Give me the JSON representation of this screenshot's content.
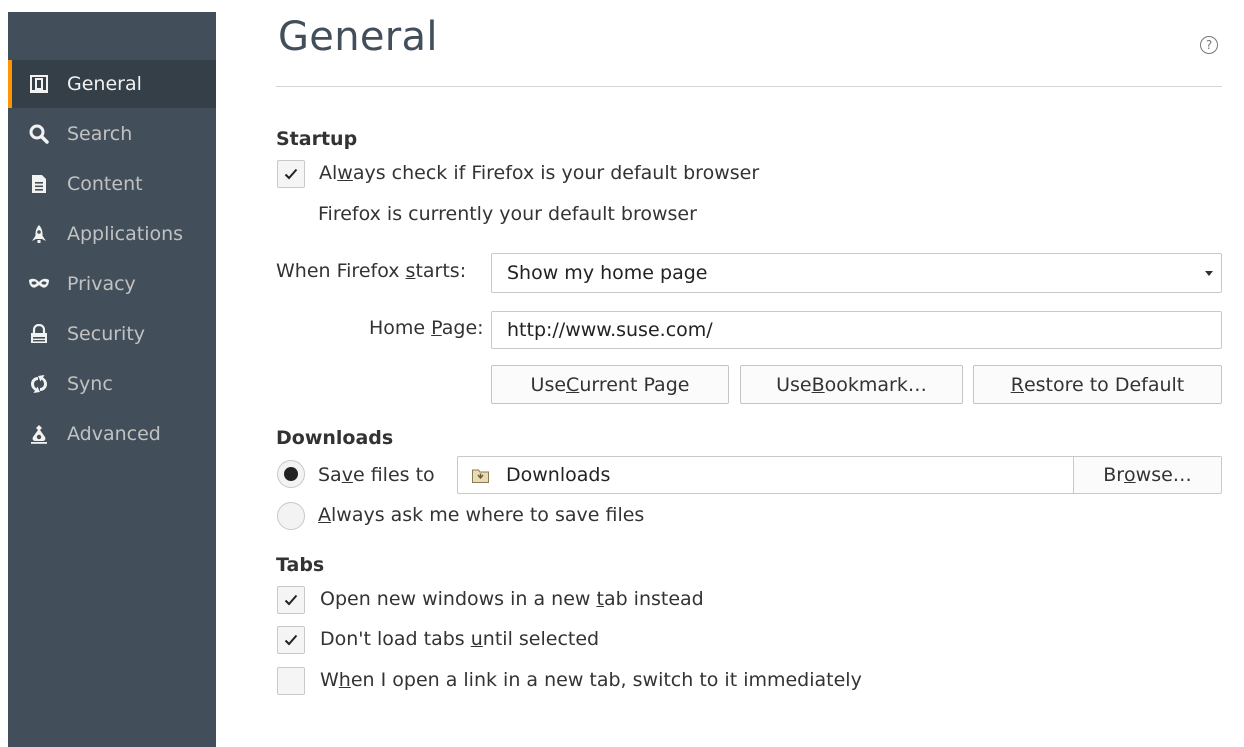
{
  "sidebar": {
    "items": [
      {
        "label": "General",
        "icon": "general-icon",
        "selected": true
      },
      {
        "label": "Search",
        "icon": "search-icon",
        "selected": false
      },
      {
        "label": "Content",
        "icon": "content-icon",
        "selected": false
      },
      {
        "label": "Applications",
        "icon": "applications-icon",
        "selected": false
      },
      {
        "label": "Privacy",
        "icon": "privacy-icon",
        "selected": false
      },
      {
        "label": "Security",
        "icon": "security-icon",
        "selected": false
      },
      {
        "label": "Sync",
        "icon": "sync-icon",
        "selected": false
      },
      {
        "label": "Advanced",
        "icon": "advanced-icon",
        "selected": false
      }
    ]
  },
  "main": {
    "title": "General",
    "help_icon": "?",
    "startup": {
      "header": "Startup",
      "default_check": {
        "pre": "Al",
        "u": "w",
        "post": "ays check if Firefox is your default browser",
        "checked": true
      },
      "default_status": "Firefox is currently your default browser",
      "when_starts": {
        "pre": "When Firefox ",
        "u": "s",
        "post": "tarts:",
        "value": "Show my home page"
      },
      "home_page": {
        "pre": "Home ",
        "u": "P",
        "post": "age:",
        "value": "http://www.suse.com/"
      },
      "buttons": {
        "current": {
          "pre": "Use ",
          "u": "C",
          "post": "urrent Page"
        },
        "bookmark": {
          "pre": "Use ",
          "u": "B",
          "post": "ookmark…"
        },
        "restore": {
          "pre": "",
          "u": "R",
          "post": "estore to Default"
        }
      }
    },
    "downloads": {
      "header": "Downloads",
      "save_to": {
        "pre": "Sa",
        "u": "v",
        "post": "e files to",
        "selected": true
      },
      "folder": "Downloads",
      "browse": {
        "pre": "Br",
        "u": "o",
        "post": "wse…"
      },
      "ask": {
        "pre": "",
        "u": "A",
        "post": "lways ask me where to save files",
        "selected": false
      }
    },
    "tabs": {
      "header": "Tabs",
      "new_windows": {
        "pre": "Open new windows in a new ",
        "u": "t",
        "post": "ab instead",
        "checked": true
      },
      "dont_load": {
        "pre": "Don't load tabs ",
        "u": "u",
        "post": "ntil selected",
        "checked": true
      },
      "switch": {
        "pre": "W",
        "u": "h",
        "post": "en I open a link in a new tab, switch to it immediately",
        "checked": false
      }
    }
  },
  "colors": {
    "sidebar_bg": "#424f5a",
    "sidebar_selected_bg": "#343f48",
    "accent": "#ff9500",
    "title": "#424e5a"
  }
}
